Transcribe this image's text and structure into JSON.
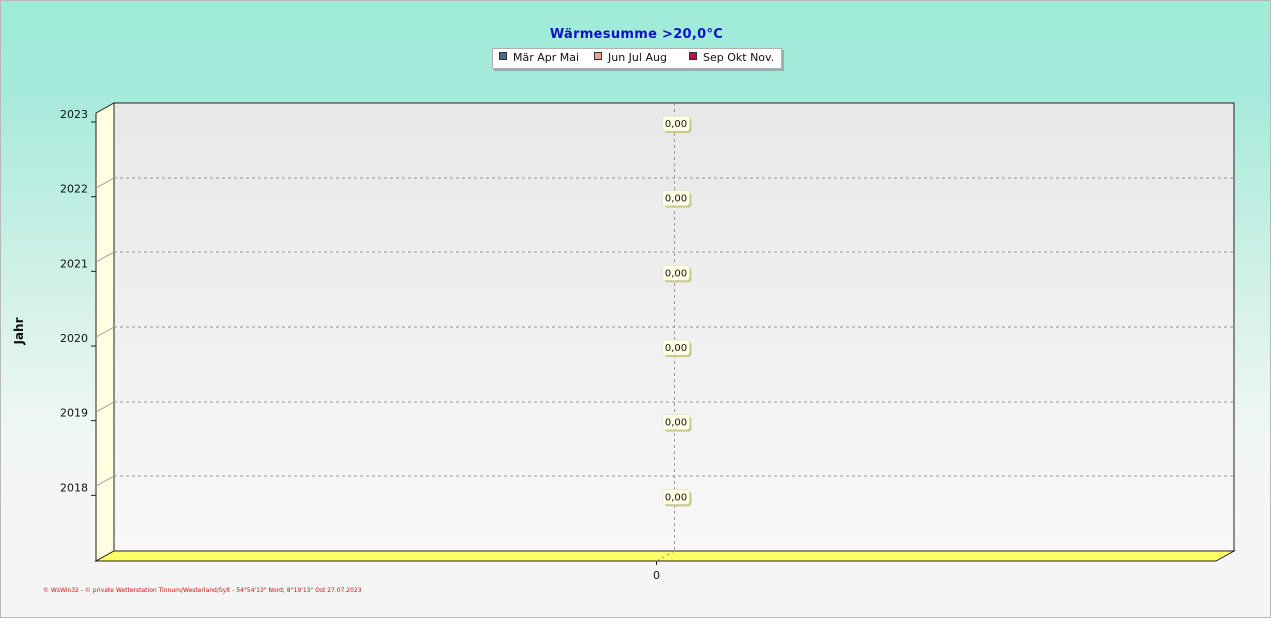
{
  "chart_data": {
    "type": "bar",
    "orientation": "horizontal",
    "title": "Wärmesumme  >20,0°C",
    "ylabel": "Jahr",
    "xlabel": "",
    "categories": [
      "2023",
      "2022",
      "2021",
      "2020",
      "2019",
      "2018"
    ],
    "series": [
      {
        "name": "Mär Apr Mai",
        "color": "#4a6b8a",
        "values": [
          0,
          0,
          0,
          0,
          0,
          0
        ]
      },
      {
        "name": "Jun Jul Aug",
        "color": "#f0a0a0",
        "values": [
          0,
          0,
          0,
          0,
          0,
          0
        ]
      },
      {
        "name": "Sep Okt Nov.",
        "color": "#c0104a",
        "values": [
          0,
          0,
          0,
          0,
          0,
          0
        ]
      }
    ],
    "data_labels": [
      "0,00",
      "0,00",
      "0,00",
      "0,00",
      "0,00",
      "0,00"
    ],
    "x_ticks": [
      "0"
    ],
    "grid": true,
    "legend_position": "top-center"
  },
  "footer": "© WsWin32  -  © private Wetterstation Tinnum/Westerland/Sylt  -  54°54'13\" Nord; 8°19'13\" Ost  27.07.2023"
}
